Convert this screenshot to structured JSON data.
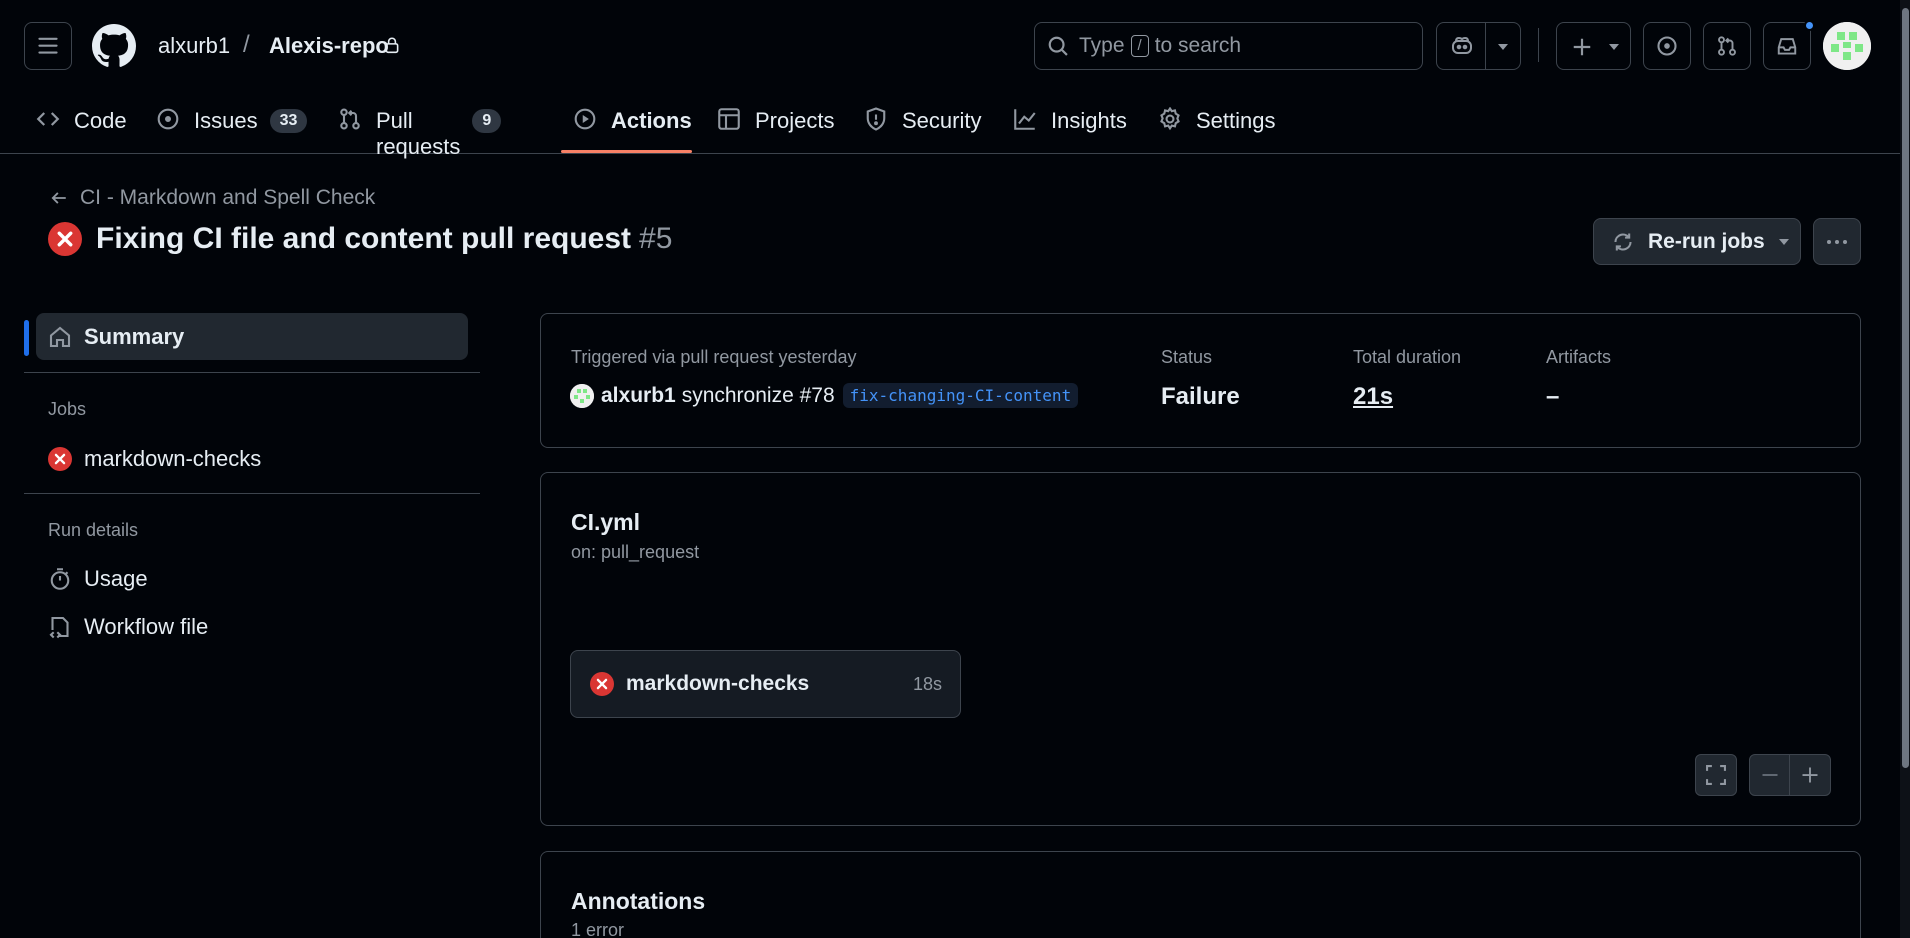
{
  "header": {
    "owner": "alxurb1",
    "repo": "Alexis-repo",
    "search": {
      "prefix": "Type",
      "key": "/",
      "suffix": "to search"
    }
  },
  "tabs": [
    {
      "label": "Code",
      "icon": "code-icon"
    },
    {
      "label": "Issues",
      "icon": "issue-icon",
      "count": "33"
    },
    {
      "label": "Pull requests",
      "icon": "pull-request-icon",
      "count": "9"
    },
    {
      "label": "Actions",
      "icon": "play-icon",
      "active": true
    },
    {
      "label": "Projects",
      "icon": "table-icon"
    },
    {
      "label": "Security",
      "icon": "shield-icon"
    },
    {
      "label": "Insights",
      "icon": "graph-icon"
    },
    {
      "label": "Settings",
      "icon": "gear-icon"
    }
  ],
  "run": {
    "workflow_name": "CI - Markdown and Spell Check",
    "title": "Fixing CI file and content pull request",
    "number": "#5",
    "status_icon": "x-circle-fill-icon",
    "rerun_label": "Re-run jobs"
  },
  "sidebar": {
    "summary_label": "Summary",
    "jobs_heading": "Jobs",
    "jobs": [
      {
        "label": "markdown-checks",
        "status_icon": "x-circle-fill-icon"
      }
    ],
    "run_details_heading": "Run details",
    "details": [
      {
        "label": "Usage",
        "icon": "stopwatch-icon"
      },
      {
        "label": "Workflow file",
        "icon": "file-code-icon"
      }
    ]
  },
  "summary": {
    "triggered_label": "Triggered via pull request yesterday",
    "actor": "alxurb1",
    "event": "synchronize #78",
    "branch": "fix-changing-CI-content",
    "status_label": "Status",
    "status_value": "Failure",
    "duration_label": "Total duration",
    "duration_value": "21s",
    "artifacts_label": "Artifacts",
    "artifacts_value": "–"
  },
  "workflow": {
    "file": "CI.yml",
    "trigger": "on: pull_request",
    "job": {
      "name": "markdown-checks",
      "duration": "18s"
    }
  },
  "annotations": {
    "title": "Annotations",
    "count": "1 error"
  },
  "colors": {
    "background": "#010409",
    "border": "#3d444d",
    "danger": "#da3633",
    "accent": "#1f6feb",
    "active_tab": "#f78166",
    "link": "#4493f8"
  }
}
